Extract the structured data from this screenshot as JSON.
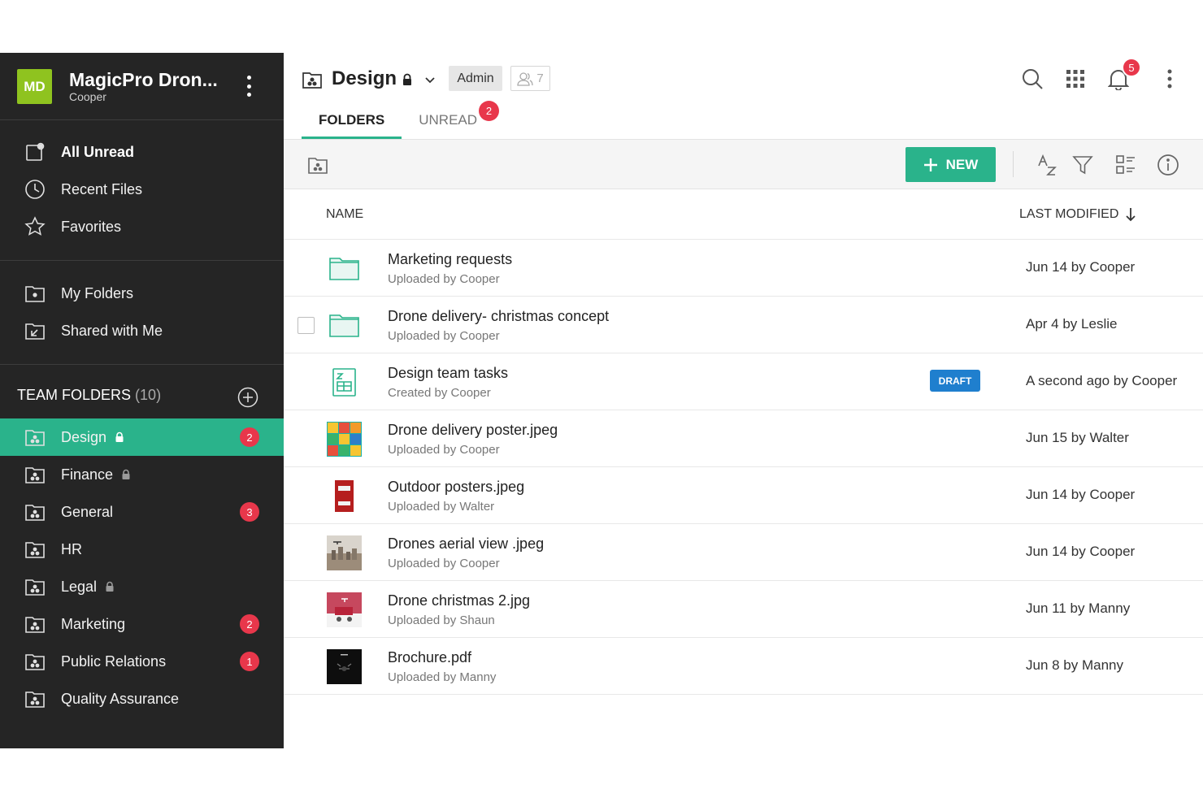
{
  "org": {
    "initials": "MD",
    "name": "MagicPro Dron...",
    "user": "Cooper"
  },
  "sidebar": {
    "quick": [
      {
        "label": "All Unread",
        "icon": "unread-icon"
      },
      {
        "label": "Recent Files",
        "icon": "clock-icon"
      },
      {
        "label": "Favorites",
        "icon": "star-icon"
      }
    ],
    "personal": [
      {
        "label": "My Folders",
        "icon": "folder-icon"
      },
      {
        "label": "Shared with Me",
        "icon": "shared-folder-icon"
      }
    ],
    "team_title": "TEAM FOLDERS",
    "team_count": "(10)",
    "team": [
      {
        "label": "Design",
        "locked": true,
        "badge": "2",
        "active": true
      },
      {
        "label": "Finance",
        "locked": true,
        "badge": ""
      },
      {
        "label": "General",
        "locked": false,
        "badge": "3"
      },
      {
        "label": "HR",
        "locked": false,
        "badge": ""
      },
      {
        "label": "Legal",
        "locked": true,
        "badge": ""
      },
      {
        "label": "Marketing",
        "locked": false,
        "badge": "2"
      },
      {
        "label": "Public Relations",
        "locked": false,
        "badge": "1"
      },
      {
        "label": "Quality Assurance",
        "locked": false,
        "badge": ""
      }
    ]
  },
  "header": {
    "title": "Design",
    "role": "Admin",
    "members": "7",
    "tabs": [
      {
        "label": "FOLDERS",
        "active": true,
        "badge": ""
      },
      {
        "label": "UNREAD",
        "active": false,
        "badge": "2"
      }
    ],
    "notifications": "5"
  },
  "toolbar": {
    "new_label": "NEW"
  },
  "list": {
    "col_name": "NAME",
    "col_modified": "LAST MODIFIED",
    "rows": [
      {
        "name": "Marketing requests",
        "sub": "Uploaded by Cooper",
        "modified": "Jun 14 by Cooper",
        "type": "folder",
        "draft": "",
        "checkbox": false
      },
      {
        "name": "Drone delivery- christmas concept",
        "sub": "Uploaded by Cooper",
        "modified": "Apr 4 by Leslie",
        "type": "folder",
        "draft": "",
        "checkbox": true
      },
      {
        "name": "Design team tasks",
        "sub": "Created by Cooper",
        "modified": "A second ago by Cooper",
        "type": "sheet",
        "draft": "DRAFT",
        "checkbox": false
      },
      {
        "name": "Drone delivery poster.jpeg",
        "sub": "Uploaded by Cooper",
        "modified": "Jun 15 by Walter",
        "type": "img-posters",
        "draft": "",
        "checkbox": false
      },
      {
        "name": "Outdoor posters.jpeg",
        "sub": "Uploaded by Walter",
        "modified": "Jun 14 by Cooper",
        "type": "img-red",
        "draft": "",
        "checkbox": false
      },
      {
        "name": "Drones aerial view .jpeg",
        "sub": "Uploaded by Cooper",
        "modified": "Jun 14 by Cooper",
        "type": "img-aerial",
        "draft": "",
        "checkbox": false
      },
      {
        "name": "Drone christmas 2.jpg",
        "sub": "Uploaded by Shaun",
        "modified": "Jun 11 by Manny",
        "type": "img-xmas",
        "draft": "",
        "checkbox": false
      },
      {
        "name": "Brochure.pdf",
        "sub": "Uploaded by Manny",
        "modified": "Jun 8 by Manny",
        "type": "img-dark",
        "draft": "",
        "checkbox": false
      }
    ]
  },
  "colors": {
    "accent": "#2ab38b",
    "badge": "#e8374b",
    "sidebar_bg": "#252525",
    "avatar": "#8fc31f",
    "draft": "#1f7fce"
  }
}
